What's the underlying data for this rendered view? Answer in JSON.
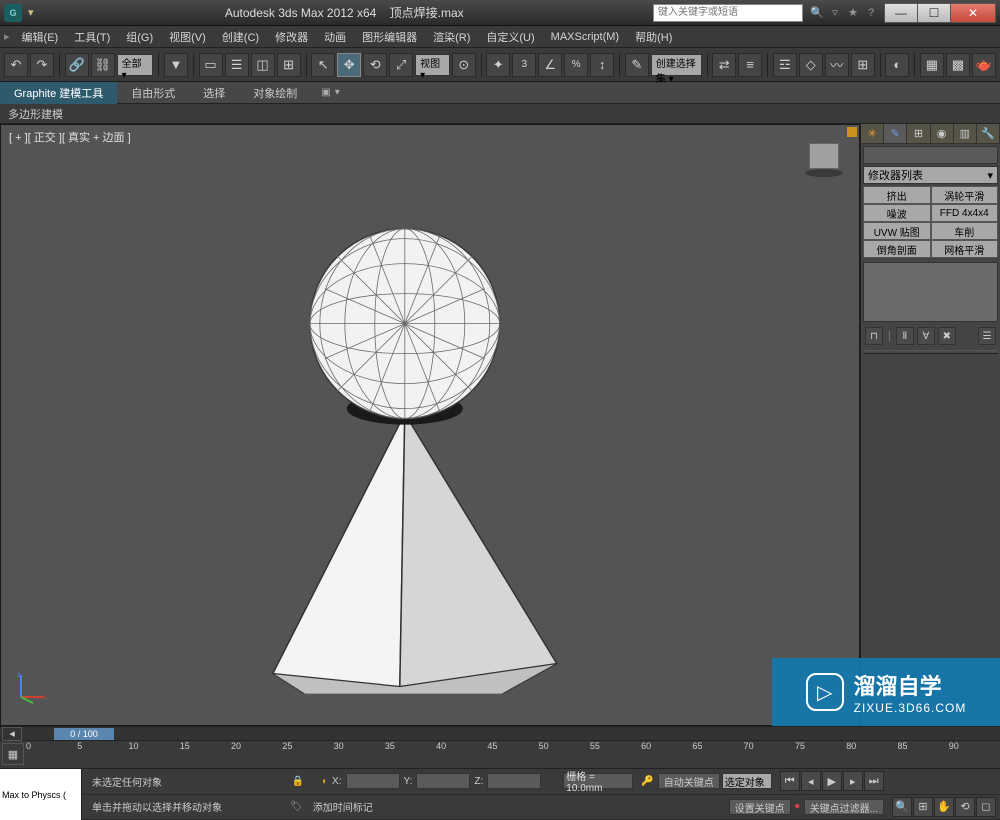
{
  "titlebar": {
    "app": "Autodesk 3ds Max 2012 x64",
    "doc": "顶点焊接.max",
    "search_placeholder": "键入关键字或短语"
  },
  "win": {
    "min": "—",
    "max": "☐",
    "close": "✕"
  },
  "menu": [
    "编辑(E)",
    "工具(T)",
    "组(G)",
    "视图(V)",
    "创建(C)",
    "修改器",
    "动画",
    "图形编辑器",
    "渲染(R)",
    "自定义(U)",
    "MAXScript(M)",
    "帮助(H)"
  ],
  "toolbar": {
    "scope_drop": "全部",
    "view_drop": "视图",
    "selset_drop": "创建选择集"
  },
  "ribbon": {
    "tabs": [
      "Graphite 建模工具",
      "自由形式",
      "选择",
      "对象绘制"
    ],
    "sub": "多边形建模"
  },
  "viewport": {
    "label": "[ + ][ 正交 ][ 真实 + 边面 ]"
  },
  "cmd_panel": {
    "mod_list": "修改器列表",
    "mods": [
      "挤出",
      "涡轮平滑",
      "噪波",
      "FFD 4x4x4",
      "UVW 贴图",
      "车削",
      "倒角剖面",
      "网格平滑"
    ]
  },
  "timeline": {
    "frame_label": "0 / 100",
    "ticks": [
      "0",
      "5",
      "10",
      "15",
      "20",
      "25",
      "30",
      "35",
      "40",
      "45",
      "50",
      "55",
      "60",
      "65",
      "70",
      "75",
      "80",
      "85",
      "90"
    ]
  },
  "status": {
    "script_btn": "Max to Physcs (",
    "line1": "未选定任何对象",
    "line2": "单击并拖动以选择并移动对象",
    "add_time_tag": "添加时间标记",
    "coords": {
      "x": "X:",
      "y": "Y:",
      "z": "Z:"
    },
    "grid": "栅格 = 10.0mm",
    "auto_key": "自动关键点",
    "sel_lock": "选定对象",
    "set_key": "设置关键点",
    "key_filter": "关键点过滤器..."
  },
  "watermark": {
    "brand": "溜溜自学",
    "url": "ZIXUE.3D66.COM"
  }
}
